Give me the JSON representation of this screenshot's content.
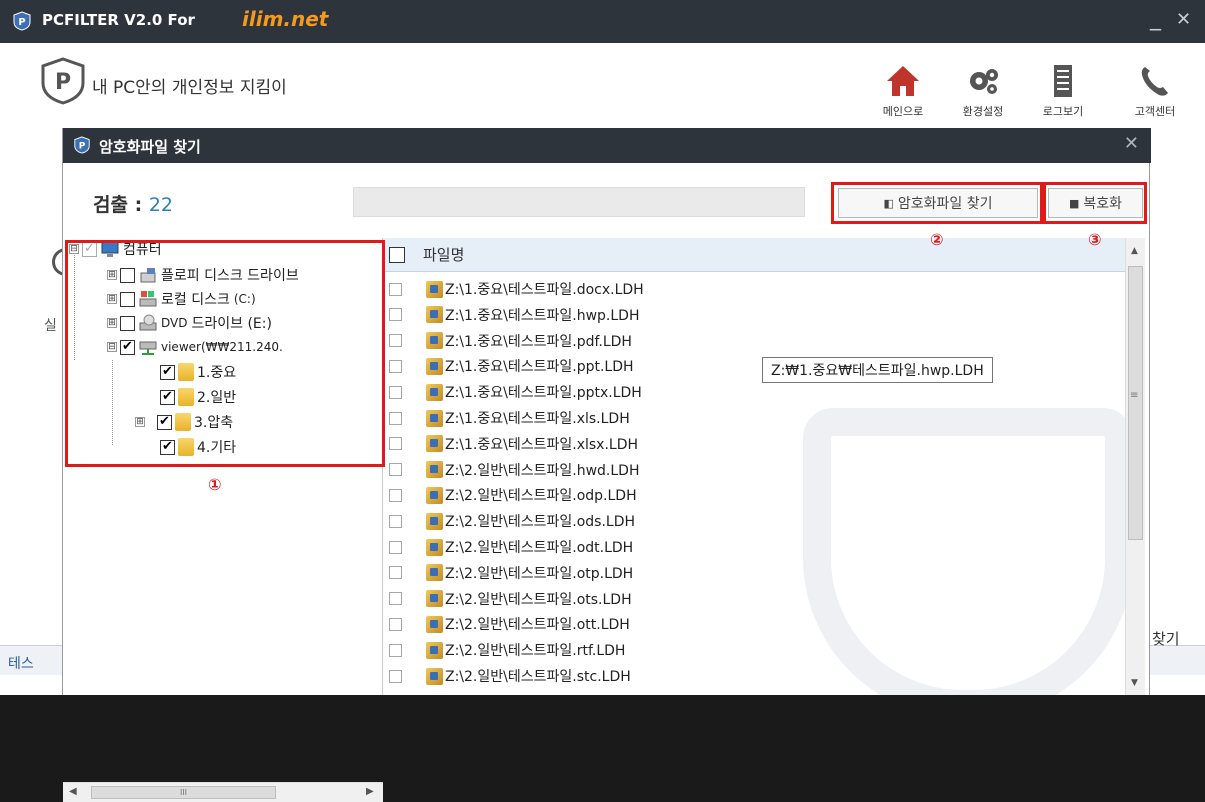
{
  "app": {
    "title": "PCFILTER V2.0 For",
    "brand": "ilim.net",
    "minimize": "_",
    "close": "✕",
    "tagline": "내 PC안의 개인정보 지킴이"
  },
  "nav": [
    {
      "label": "메인으로",
      "icon": "home-icon",
      "color": "#c0352b"
    },
    {
      "label": "환경설정",
      "icon": "gears-icon",
      "color": "#555555"
    },
    {
      "label": "로그보기",
      "icon": "log-icon",
      "color": "#555555"
    },
    {
      "label": "고객센터",
      "icon": "phone-icon",
      "color": "#555555"
    }
  ],
  "background": {
    "left_text": "실",
    "bottom_text": "테스",
    "right_text": "찾기"
  },
  "dialog": {
    "title": "암호화파일 찾기",
    "close": "✕",
    "count_label": "검출 :",
    "count_value": "22",
    "progress": 0.0,
    "find_button": "암호화파일 찾기",
    "decrypt_button": "복호화",
    "callouts": [
      "①",
      "②",
      "③"
    ]
  },
  "tree": [
    {
      "label": "컴퓨터",
      "expander": "⊟",
      "checked": "✓",
      "icon": "computer-icon"
    },
    {
      "label": "플로피 디스크 드라이브",
      "expander": "⊞",
      "checked": "",
      "icon": "floppy-icon"
    },
    {
      "label": "로컬 디스크",
      "suffix": "(C:)",
      "expander": "⊞",
      "checked": "",
      "icon": "local-disk-icon"
    },
    {
      "label": "DVD",
      "suffix": "드라이브 (E:)",
      "expander": "⊞",
      "checked": "",
      "icon": "dvd-icon"
    },
    {
      "label": "viewer(₩₩211.240.",
      "expander": "⊟",
      "checked": "✔",
      "icon": "network-drive-icon"
    },
    {
      "label": "1.중요",
      "expander": "",
      "checked": "✔",
      "icon": "folder-icon"
    },
    {
      "label": "2.일반",
      "expander": "",
      "checked": "✔",
      "icon": "folder-icon"
    },
    {
      "label": "3.압축",
      "expander": "⊞",
      "checked": "✔",
      "icon": "folder-icon"
    },
    {
      "label": "4.기타",
      "expander": "",
      "checked": "✔",
      "icon": "folder-icon"
    }
  ],
  "list": {
    "header": "파일명",
    "tooltip": "Z:₩1.중요₩테스트파일.hwp.LDH",
    "files": [
      "Z:\\1.중요\\테스트파일.docx.LDH",
      "Z:\\1.중요\\테스트파일.hwp.LDH",
      "Z:\\1.중요\\테스트파일.pdf.LDH",
      "Z:\\1.중요\\테스트파일.ppt.LDH",
      "Z:\\1.중요\\테스트파일.pptx.LDH",
      "Z:\\1.중요\\테스트파일.xls.LDH",
      "Z:\\1.중요\\테스트파일.xlsx.LDH",
      "Z:\\2.일반\\테스트파일.hwd.LDH",
      "Z:\\2.일반\\테스트파일.odp.LDH",
      "Z:\\2.일반\\테스트파일.ods.LDH",
      "Z:\\2.일반\\테스트파일.odt.LDH",
      "Z:\\2.일반\\테스트파일.otp.LDH",
      "Z:\\2.일반\\테스트파일.ots.LDH",
      "Z:\\2.일반\\테스트파일.ott.LDH",
      "Z:\\2.일반\\테스트파일.rtf.LDH",
      "Z:\\2.일반\\테스트파일.stc.LDH"
    ]
  },
  "scroll": {
    "up": "▲",
    "down": "▼",
    "left": "◀",
    "right": "▶",
    "grip_v": "≡",
    "grip_h": "III"
  }
}
